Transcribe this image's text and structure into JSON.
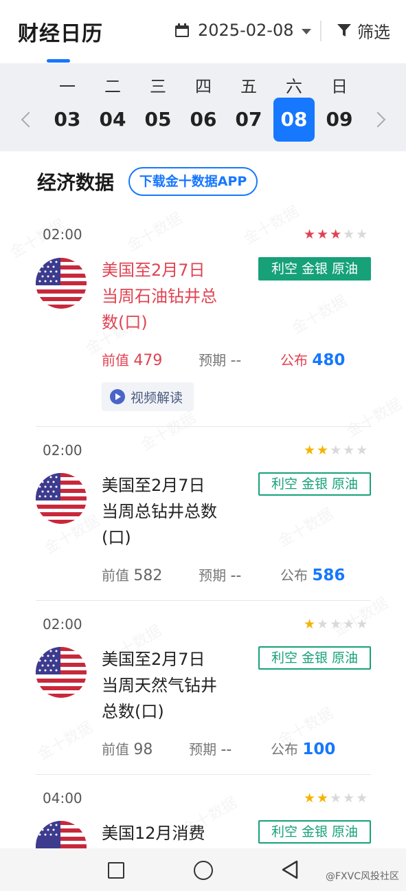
{
  "header": {
    "title": "财经日历",
    "date": "2025-02-08",
    "filter_label": "筛选"
  },
  "week": {
    "weekdays": [
      "一",
      "二",
      "三",
      "四",
      "五",
      "六",
      "日"
    ],
    "days": [
      "03",
      "04",
      "05",
      "06",
      "07",
      "08",
      "09"
    ],
    "selected_index": 5
  },
  "section": {
    "title": "经济数据",
    "download_label": "下载金十数据APP"
  },
  "events": [
    {
      "time": "02:00",
      "stars": 3,
      "name": "美国至2月7日当周石油钻井总数(口)",
      "tag": "利空 金银 原油",
      "prev_label": "前值",
      "prev": "479",
      "forecast_label": "预期",
      "forecast": "--",
      "actual_label": "公布",
      "actual": "480",
      "video_label": "视频解读",
      "highlight": true
    },
    {
      "time": "02:00",
      "stars": 2,
      "name": "美国至2月7日当周总钻井总数(口)",
      "tag": "利空 金银 原油",
      "prev_label": "前值",
      "prev": "582",
      "forecast_label": "预期",
      "forecast": "--",
      "actual_label": "公布",
      "actual": "586",
      "highlight": false
    },
    {
      "time": "02:00",
      "stars": 1,
      "name": "美国至2月7日当周天然气钻井总数(口)",
      "tag": "利空 金银 原油",
      "prev_label": "前值",
      "prev": "98",
      "forecast_label": "预期",
      "forecast": "--",
      "actual_label": "公布",
      "actual": "100",
      "highlight": false
    },
    {
      "time": "04:00",
      "stars": 2,
      "name": "美国12月消费",
      "tag": "利空 金银 原油",
      "highlight": false
    }
  ],
  "watermark_text": "金十数据",
  "credit": "@FXVC风投社区",
  "colors": {
    "accent": "#1677ff",
    "bearish_red": "#e04352",
    "tag_green": "#16a179",
    "star_yellow": "#f5b400"
  }
}
